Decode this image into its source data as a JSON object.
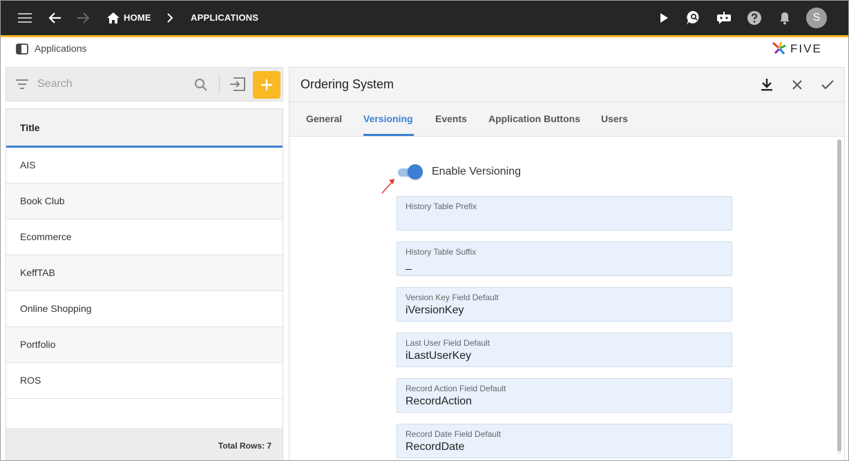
{
  "topbar": {
    "breadcrumbs": [
      "HOME",
      "APPLICATIONS"
    ],
    "avatar_initial": "S",
    "accent_color": "#f9b824"
  },
  "subheader": {
    "title": "Applications",
    "logo_text": "FIVE"
  },
  "left": {
    "search_placeholder": "Search",
    "column_header": "Title",
    "rows": [
      "AIS",
      "Book Club",
      "Ecommerce",
      "KeffTAB",
      "Online Shopping",
      "Portfolio",
      "ROS"
    ],
    "total_rows": "Total Rows: 7"
  },
  "right": {
    "title": "Ordering System",
    "tabs": [
      "General",
      "Versioning",
      "Events",
      "Application Buttons",
      "Users"
    ],
    "active_tab": "Versioning",
    "toggle_label": "Enable Versioning",
    "toggle_on": true,
    "fields": [
      {
        "label": "History Table Prefix",
        "value": ""
      },
      {
        "label": "History Table Suffix",
        "value": "_"
      },
      {
        "label": "Version Key Field Default",
        "value": "iVersionKey"
      },
      {
        "label": "Last User Field Default",
        "value": "iLastUserKey"
      },
      {
        "label": "Record Action Field Default",
        "value": "RecordAction"
      },
      {
        "label": "Record Date Field Default",
        "value": "RecordDate"
      }
    ]
  },
  "colors": {
    "primary": "#3c7fd4",
    "accent": "#f9b824",
    "field_bg": "#e8f1fc"
  }
}
